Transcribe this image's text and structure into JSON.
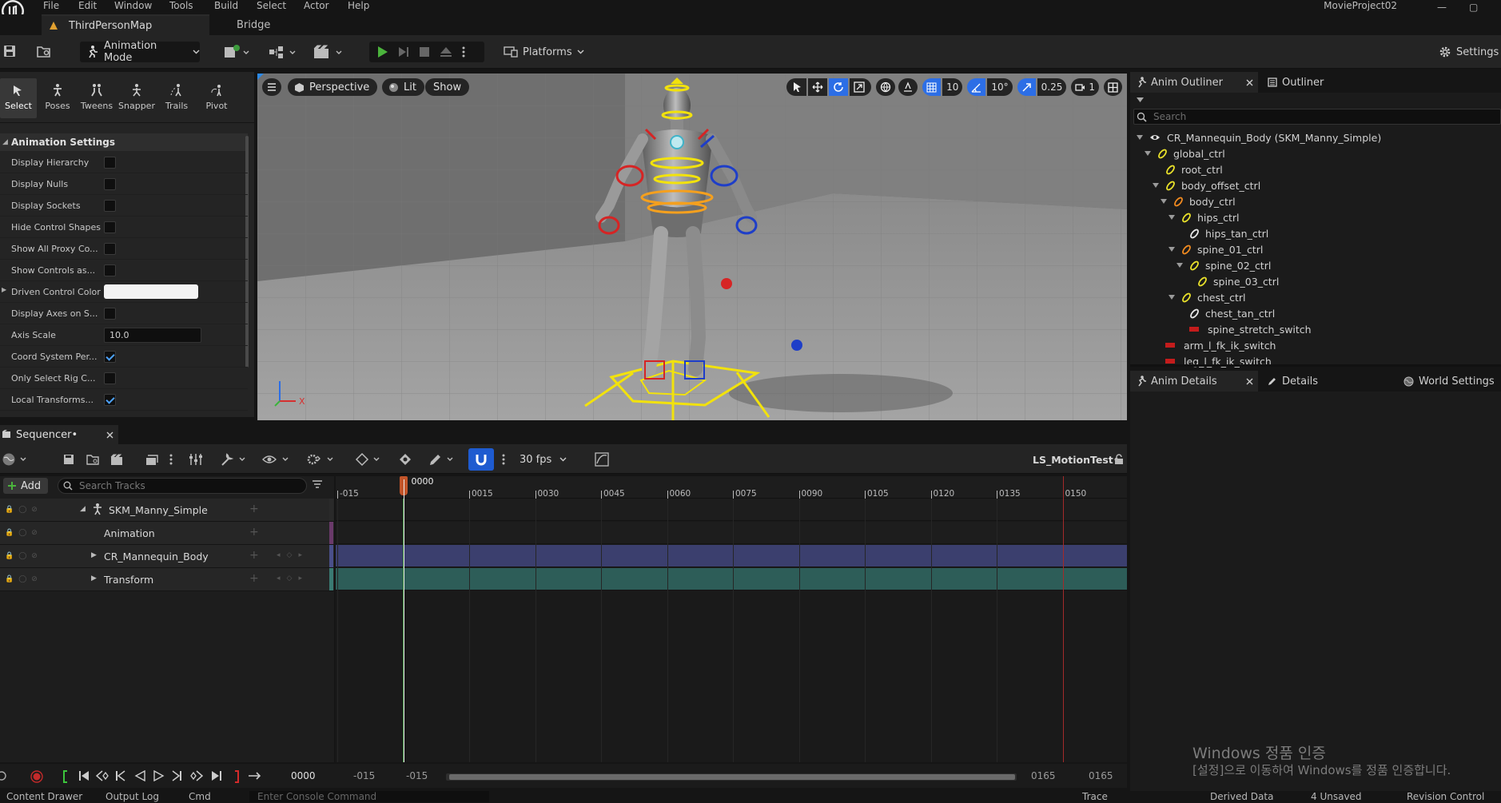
{
  "menu": [
    "File",
    "Edit",
    "Window",
    "Tools",
    "Build",
    "Select",
    "Actor",
    "Help"
  ],
  "project_name": "MovieProject02",
  "tabs": {
    "map": "ThirdPersonMap",
    "bridge": "Bridge"
  },
  "toolbar": {
    "mode": "Animation Mode",
    "platforms": "Platforms",
    "settings": "Settings"
  },
  "mode_tabs": [
    "Select",
    "Poses",
    "Tweens",
    "Snapper",
    "Trails",
    "Pivot"
  ],
  "animation_settings": {
    "header": "Animation Settings",
    "rows": [
      {
        "label": "Display Hierarchy",
        "type": "check",
        "checked": false
      },
      {
        "label": "Display Nulls",
        "type": "check",
        "checked": false
      },
      {
        "label": "Display Sockets",
        "type": "check",
        "checked": false
      },
      {
        "label": "Hide Control Shapes",
        "type": "check",
        "checked": false
      },
      {
        "label": "Show All Proxy Co...",
        "type": "check",
        "checked": false
      },
      {
        "label": "Show Controls as...",
        "type": "check",
        "checked": false
      },
      {
        "label": "Driven Control Color",
        "type": "color",
        "value": "#f3f3f3"
      },
      {
        "label": "Display Axes on S...",
        "type": "check",
        "checked": false
      },
      {
        "label": "Axis Scale",
        "type": "input",
        "value": "10.0"
      },
      {
        "label": "Coord System Per...",
        "type": "check",
        "checked": true
      },
      {
        "label": "Only Select Rig C...",
        "type": "check",
        "checked": false
      },
      {
        "label": "Local Transforms...",
        "type": "check",
        "checked": true
      }
    ]
  },
  "viewport": {
    "perspective": "Perspective",
    "lit": "Lit",
    "show": "Show",
    "grid_snap": "10",
    "rot_snap": "10°",
    "scale_snap": "0.25",
    "camera_speed": "1"
  },
  "anim_outliner": {
    "tab": "Anim Outliner",
    "tab2": "Outliner",
    "search_placeholder": "Search",
    "items": [
      {
        "label": "CR_Mannequin_Body  (SKM_Manny_Simple)",
        "kind": "root",
        "depth": 0,
        "arrow": true
      },
      {
        "label": "global_ctrl",
        "kind": "bone-yellow",
        "depth": 1,
        "arrow": true
      },
      {
        "label": "root_ctrl",
        "kind": "bone-yellow",
        "depth": 2,
        "arrow": false
      },
      {
        "label": "body_offset_ctrl",
        "kind": "bone-yellow",
        "depth": 2,
        "arrow": true
      },
      {
        "label": "body_ctrl",
        "kind": "bone-orange",
        "depth": 3,
        "arrow": true
      },
      {
        "label": "hips_ctrl",
        "kind": "bone-yellow",
        "depth": 4,
        "arrow": true
      },
      {
        "label": "hips_tan_ctrl",
        "kind": "bone-white",
        "depth": 5,
        "arrow": false
      },
      {
        "label": "spine_01_ctrl",
        "kind": "bone-orange",
        "depth": 4,
        "arrow": true
      },
      {
        "label": "spine_02_ctrl",
        "kind": "bone-yellow",
        "depth": 5,
        "arrow": true
      },
      {
        "label": "spine_03_ctrl",
        "kind": "bone-yellow",
        "depth": 6,
        "arrow": false
      },
      {
        "label": "chest_ctrl",
        "kind": "bone-yellow",
        "depth": 4,
        "arrow": true
      },
      {
        "label": "chest_tan_ctrl",
        "kind": "bone-white",
        "depth": 5,
        "arrow": false
      },
      {
        "label": "spine_stretch_switch",
        "kind": "switch",
        "depth": 5,
        "arrow": false
      },
      {
        "label": "arm_l_fk_ik_switch",
        "kind": "switch",
        "depth": 2,
        "arrow": false
      },
      {
        "label": "leg_l_fk_ik_switch",
        "kind": "switch",
        "depth": 2,
        "arrow": false
      }
    ]
  },
  "details_tabs": {
    "anim_details": "Anim Details",
    "details": "Details",
    "world_settings": "World Settings"
  },
  "watermark": {
    "title": "Windows 정품 인증",
    "sub": "[설정]으로 이동하여 Windows를 정품 인증합니다."
  },
  "sequencer": {
    "tab": "Sequencer•",
    "fps": "30 fps",
    "name": "LS_MotionTest•",
    "add": "Add",
    "search_placeholder": "Search Tracks",
    "tracks": [
      {
        "label": "SKM_Manny_Simple",
        "level": 0
      },
      {
        "label": "Animation",
        "level": 1
      },
      {
        "label": "CR_Mannequin_Body",
        "level": 1
      },
      {
        "label": "Transform",
        "level": 1
      }
    ],
    "ruler": [
      "-015",
      "0015",
      "0030",
      "0045",
      "0060",
      "0075",
      "0090",
      "0105",
      "0120",
      "0135",
      "0150"
    ],
    "playhead": "0000",
    "transport": {
      "current": "0000",
      "view_start": "-015",
      "work_start": "-015",
      "work_end": "0165",
      "view_end": "0165"
    }
  },
  "statusbar": [
    "Content Drawer",
    "Output Log",
    "Cmd",
    "Enter Console Command",
    "Trace",
    "Derived Data",
    "4 Unsaved",
    "Revision Control"
  ]
}
